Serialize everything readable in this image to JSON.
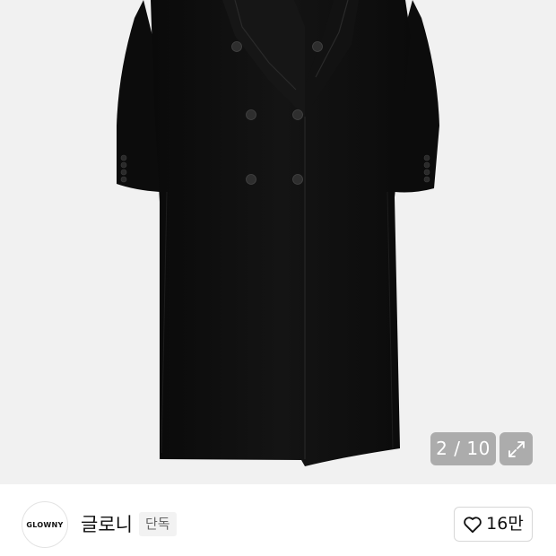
{
  "gallery": {
    "counter_text": "2 / 10",
    "current_index": 2,
    "total_images": 10,
    "expand_icon": "expand-icon",
    "background_color": "#f1f1f1"
  },
  "shop": {
    "logo_text": "GLOWNY",
    "name": "글로니",
    "badge": "단독"
  },
  "like": {
    "icon": "heart-outline-icon",
    "count": "16만"
  }
}
